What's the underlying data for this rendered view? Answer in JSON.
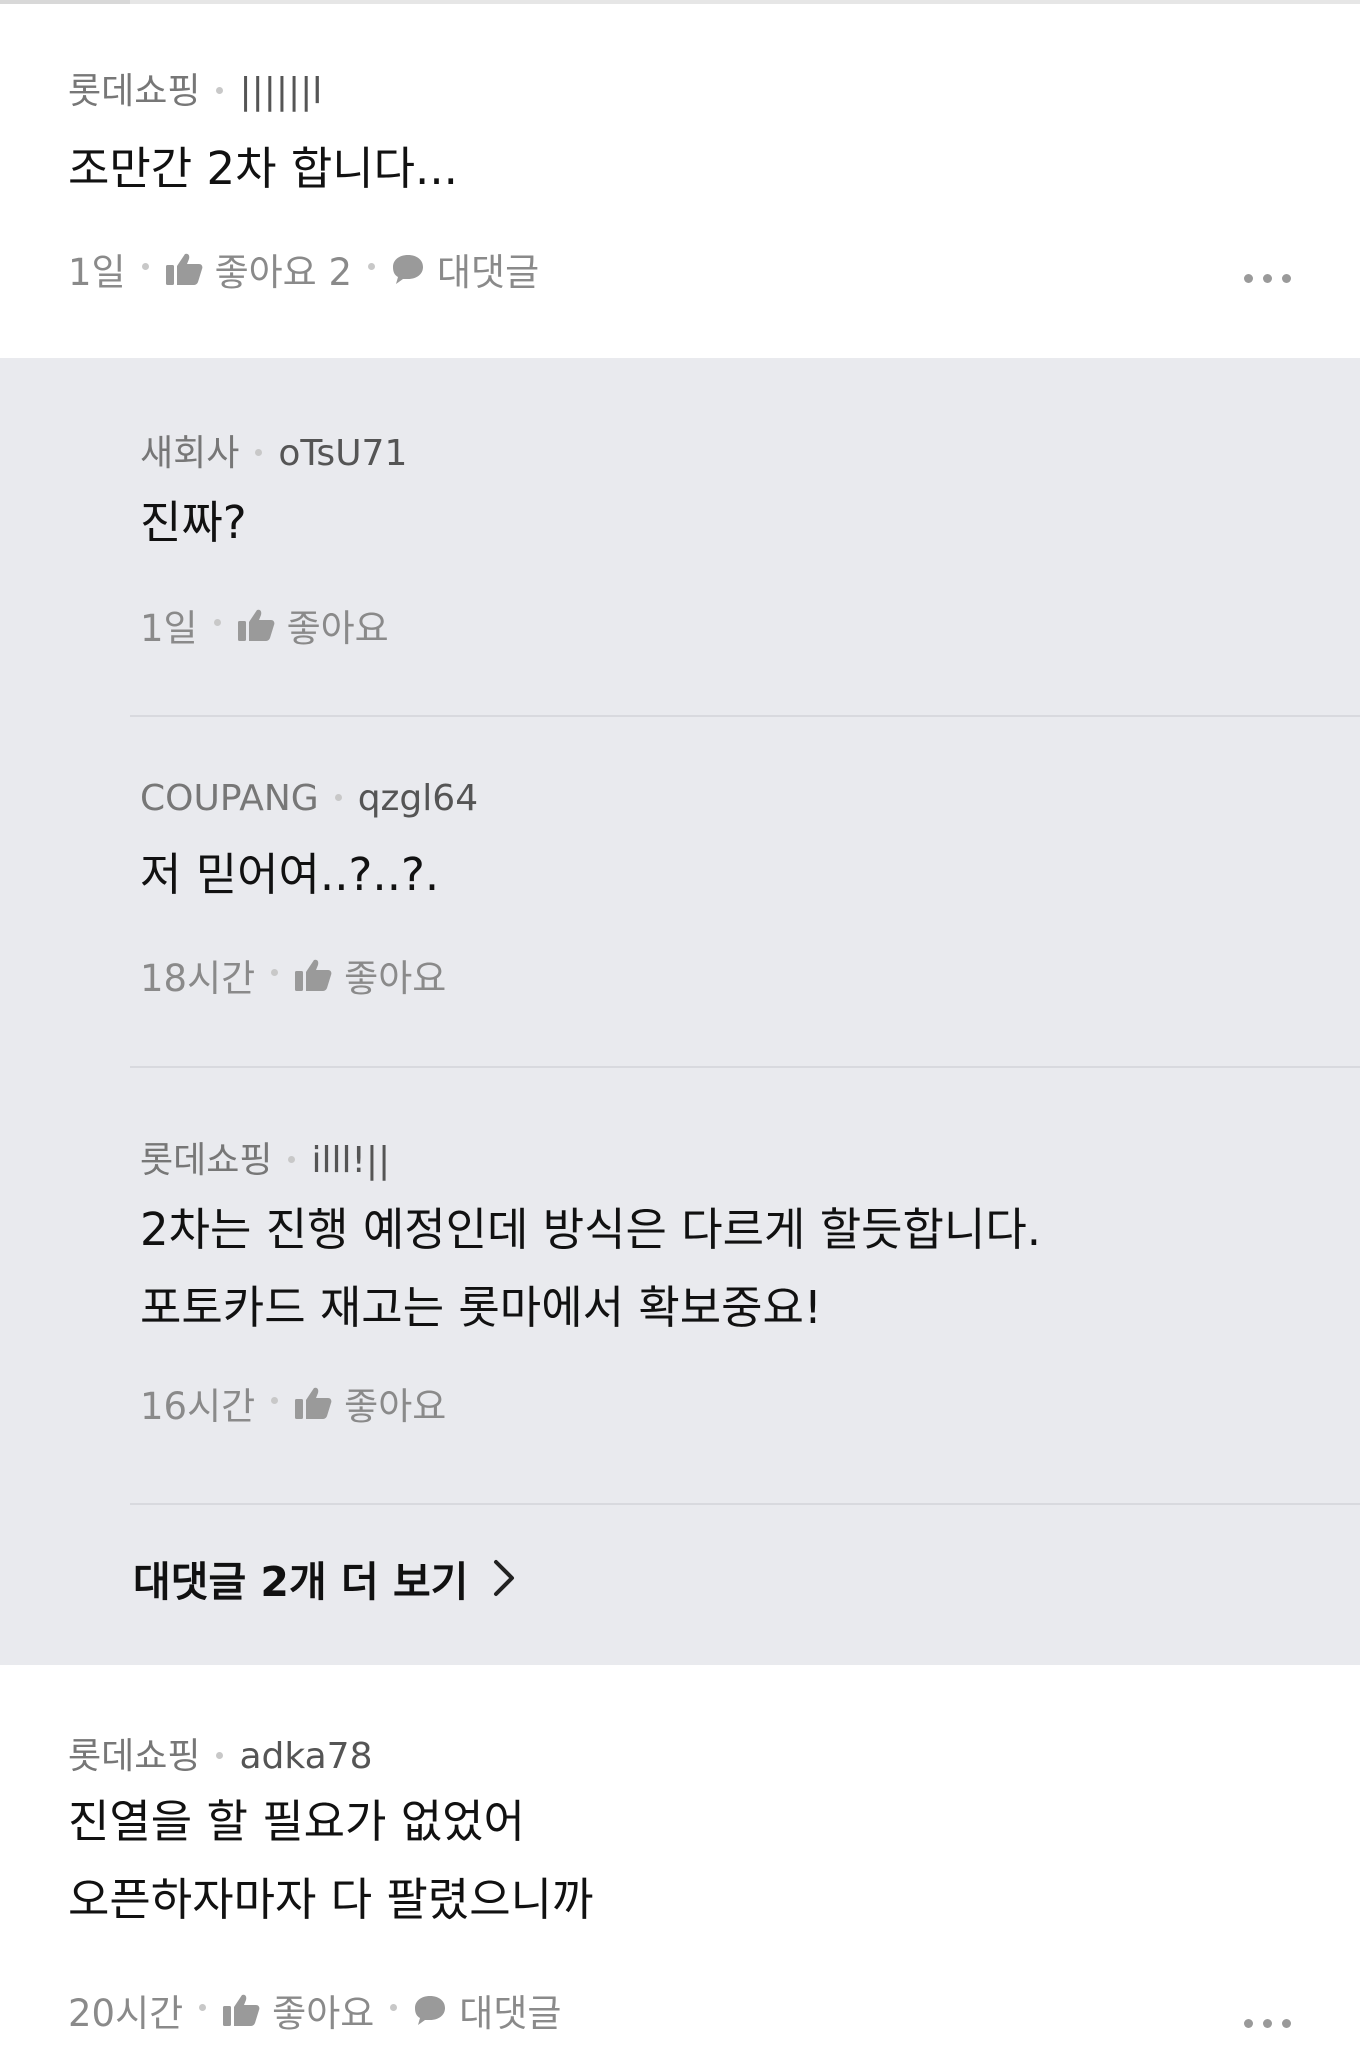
{
  "comments": [
    {
      "source": "롯데쇼핑",
      "author": "||||||l",
      "lines": [
        "조만간 2차 합니다..."
      ],
      "time": "1일",
      "like_label": "좋아요 2",
      "reply_label": "대댓글"
    },
    {
      "source": "롯데쇼핑",
      "author": "adka78",
      "lines": [
        "진열을 할 필요가 없었어",
        "오픈하자마자 다 팔렸으니까"
      ],
      "time": "20시간",
      "like_label": "좋아요",
      "reply_label": "대댓글"
    }
  ],
  "replies": [
    {
      "source": "새회사",
      "author": "oTsU71",
      "lines": [
        "진짜?"
      ],
      "time": "1일",
      "like_label": "좋아요"
    },
    {
      "source": "COUPANG",
      "author": "qzgl64",
      "lines": [
        "저 믿어여..?..?."
      ],
      "time": "18시간",
      "like_label": "좋아요"
    },
    {
      "source": "롯데쇼핑",
      "author": "illl!||",
      "lines": [
        "2차는 진행 예정인데 방식은 다르게 할듯합니다.",
        "포토카드 재고는 롯마에서 확보중요!"
      ],
      "time": "16시간",
      "like_label": "좋아요"
    }
  ],
  "more_replies_label": "대댓글 2개 더 보기",
  "icons": {
    "like": "thumbs-up-icon",
    "reply": "speech-bubble-icon",
    "more": "more-dots-icon",
    "chevron": "chevron-right-icon"
  },
  "colors": {
    "reply_background": "#e9eaee",
    "meta_text": "#777777",
    "action_text": "#8a8a8a"
  }
}
